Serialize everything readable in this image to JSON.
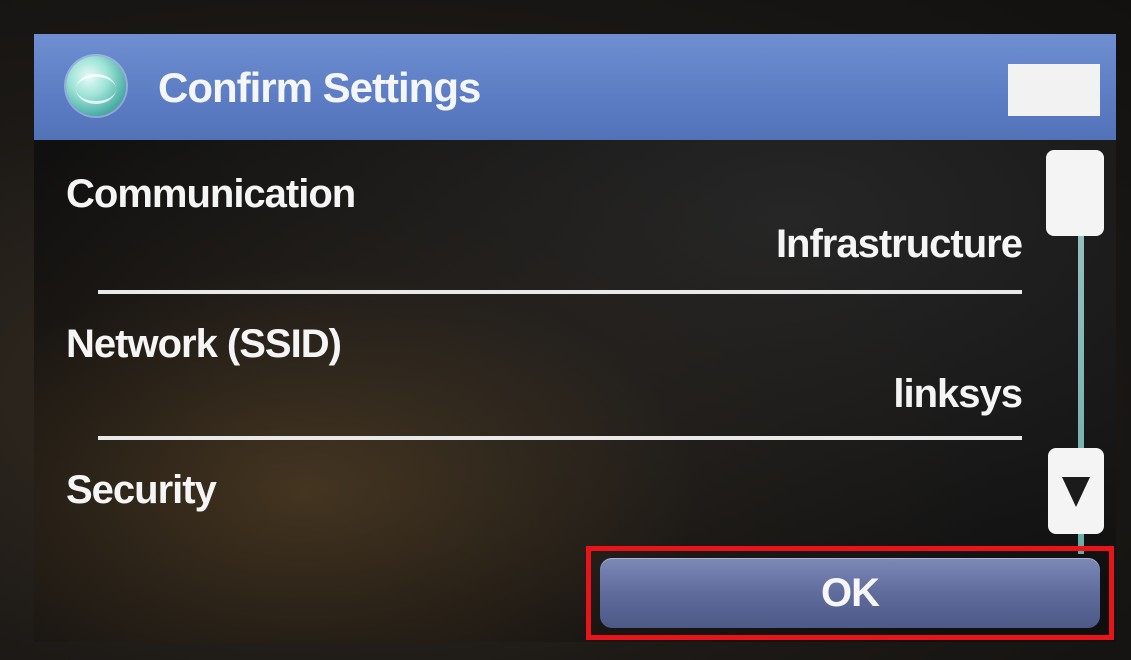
{
  "header": {
    "title": "Confirm Settings",
    "icon": "globe-icon"
  },
  "settings": [
    {
      "label": "Communication",
      "value": "Infrastructure"
    },
    {
      "label": "Network (SSID)",
      "value": "linksys"
    },
    {
      "label": "Security",
      "value": ""
    }
  ],
  "scrollbar": {
    "down_icon": "triangle-down-icon"
  },
  "ok_button": {
    "label": "OK",
    "highlight_color": "#e8141a"
  },
  "colors": {
    "titlebar": "#5c7cc4",
    "ok_button": "#5f6c9c"
  }
}
